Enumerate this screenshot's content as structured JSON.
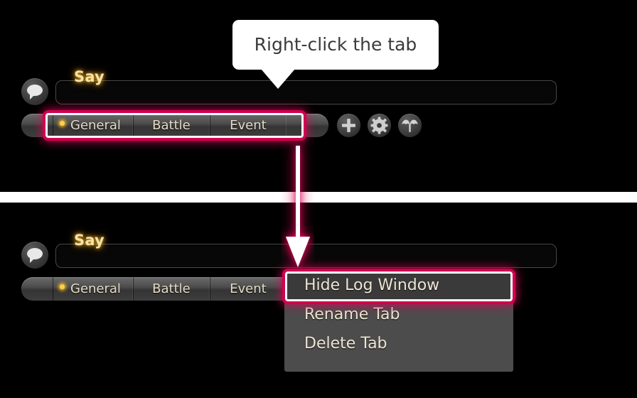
{
  "app": {
    "chat_label": "Say",
    "chat_input_value": "",
    "chat_input_placeholder": ""
  },
  "icons": {
    "chat": "speech-bubble-icon",
    "add": "plus-icon",
    "settings": "gear-icon",
    "umbrella": "umbrella-icon",
    "active_dot": "active-tab-dot"
  },
  "tabs": [
    {
      "label": "General",
      "active": true
    },
    {
      "label": "Battle",
      "active": false
    },
    {
      "label": "Event",
      "active": false
    }
  ],
  "tooltip": {
    "text": "Right-click the tab"
  },
  "context_menu": {
    "items": [
      {
        "label": "Hide Log Window",
        "selected": true
      },
      {
        "label": "Rename Tab",
        "selected": false
      },
      {
        "label": "Delete Tab",
        "selected": false
      }
    ]
  },
  "colors": {
    "highlight_pink": "#d2004f",
    "highlight_inner": "#ffffff",
    "say_gold": "#f3e2a8",
    "tab_text": "#e6ddc8",
    "menu_bg": "#4c4c4c",
    "menu_selected_bg": "#3a3a3a",
    "background": "#000000",
    "divider": "#ffffff"
  }
}
